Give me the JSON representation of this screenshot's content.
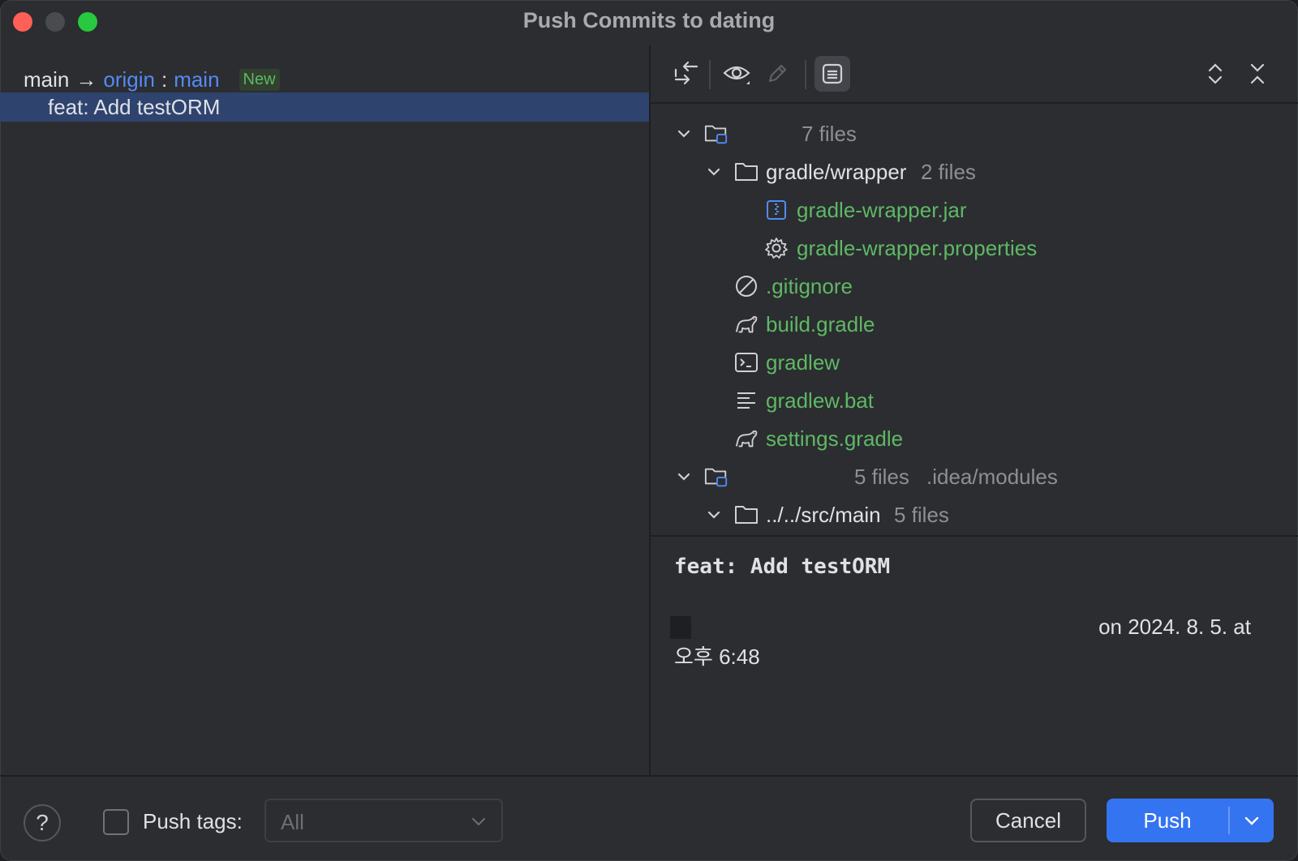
{
  "window": {
    "title": "Push Commits to dating"
  },
  "left": {
    "branch": {
      "local": "main",
      "arrow": "→",
      "remote": "origin",
      "colon": ":",
      "remote_branch": "main",
      "badge": "New"
    },
    "commit": "feat: Add testORM"
  },
  "tree": {
    "group1": {
      "name": "",
      "count": "7 files"
    },
    "folder1": {
      "name": "gradle/wrapper",
      "count": "2 files"
    },
    "files": [
      {
        "name": "gradle-wrapper.jar",
        "icon": "jar-icon"
      },
      {
        "name": "gradle-wrapper.properties",
        "icon": "gear-icon"
      },
      {
        "name": ".gitignore",
        "icon": "ignore-icon"
      },
      {
        "name": "build.gradle",
        "icon": "gradle-icon"
      },
      {
        "name": "gradlew",
        "icon": "terminal-icon"
      },
      {
        "name": "gradlew.bat",
        "icon": "text-lines-icon"
      },
      {
        "name": "settings.gradle",
        "icon": "gradle-icon"
      }
    ],
    "group2": {
      "count": "5 files",
      "path": ".idea/modules"
    },
    "folder2": {
      "name": "../../src/main",
      "count": "5 files"
    }
  },
  "details": {
    "message": "feat: Add testORM",
    "date_line1": "on 2024. 8. 5. at",
    "date_line2": "오후 6:48"
  },
  "bottom": {
    "help": "?",
    "push_tags_label": "Push tags:",
    "push_tags_value": "All",
    "cancel": "Cancel",
    "push": "Push"
  },
  "colors": {
    "accent": "#3574f0",
    "added_file": "#5fb865",
    "link": "#548af7",
    "selection": "#2e436e"
  }
}
